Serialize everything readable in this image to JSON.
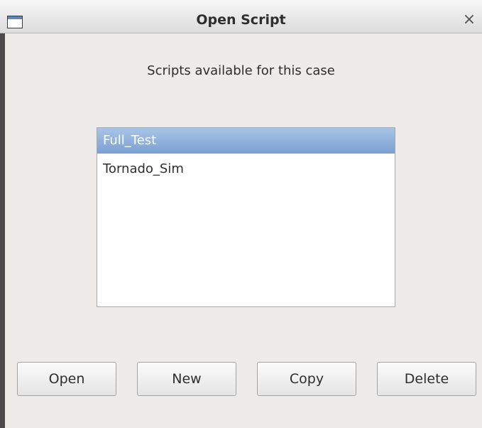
{
  "window": {
    "title": "Open Script",
    "close_glyph": "×"
  },
  "dialog": {
    "subtitle": "Scripts available for this case"
  },
  "scripts": {
    "items": [
      {
        "label": "Full_Test",
        "selected": true
      },
      {
        "label": "Tornado_Sim",
        "selected": false
      }
    ]
  },
  "buttons": {
    "open_label": "Open",
    "new_label": "New",
    "copy_label": "Copy",
    "delete_label": "Delete"
  },
  "colors": {
    "selection": "#7a9fd0",
    "window_bg": "#edeceb"
  },
  "icons": {
    "window": "window-icon",
    "close": "close-icon"
  }
}
